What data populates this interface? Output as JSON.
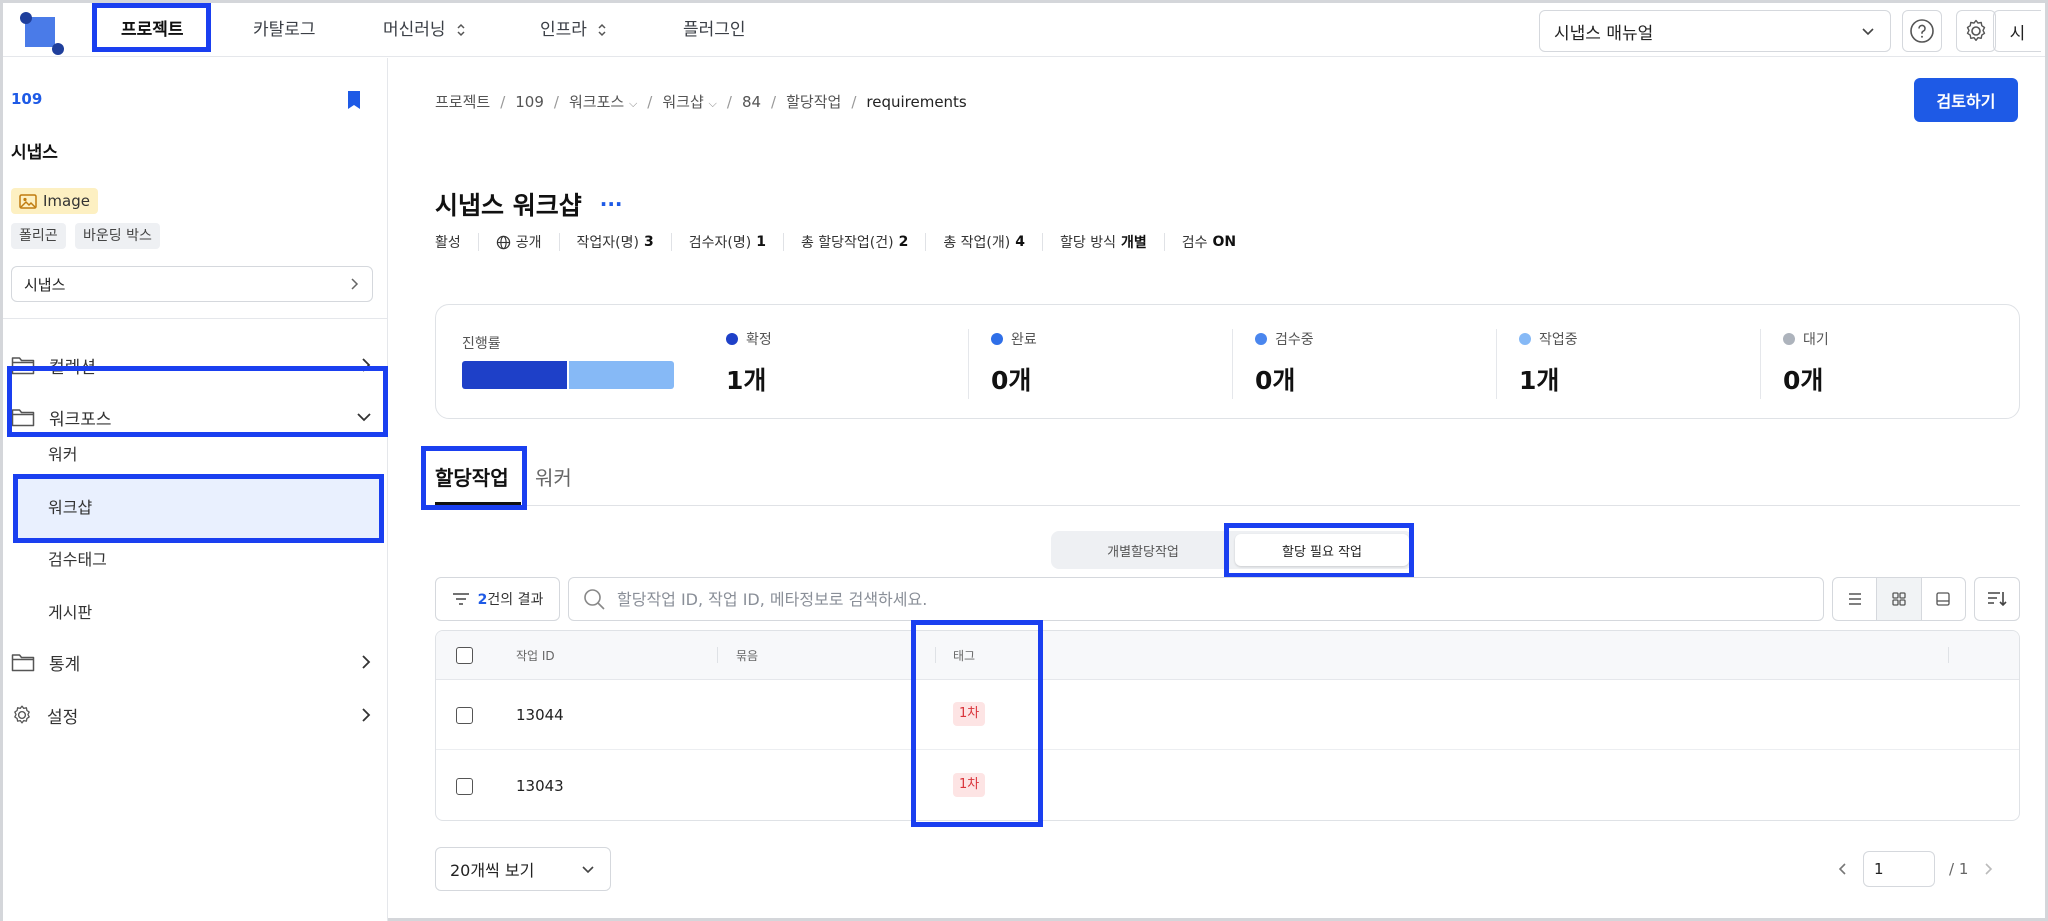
{
  "nav": {
    "items": [
      {
        "label": "프로젝트",
        "active": true,
        "dropdown": false
      },
      {
        "label": "카탈로그",
        "active": false,
        "dropdown": false
      },
      {
        "label": "머신러닝",
        "active": false,
        "dropdown": true
      },
      {
        "label": "인프라",
        "active": false,
        "dropdown": true
      },
      {
        "label": "플러그인",
        "active": false,
        "dropdown": false
      }
    ],
    "manual_select": "시냅스 매뉴얼",
    "avatar": "시"
  },
  "sidebar": {
    "project_id": "109",
    "project_name": "시냅스",
    "data_type": "Image",
    "chips": [
      "폴리곤",
      "바운딩 박스"
    ],
    "workspace_select": "시냅스",
    "menu": {
      "collection": "컬렉션",
      "workforce": "워크포스",
      "workforce_sub": [
        "워커",
        "워크샵",
        "검수태그",
        "게시판"
      ],
      "stats": "통계",
      "settings": "설정"
    }
  },
  "breadcrumb": {
    "items": [
      "프로젝트",
      "109",
      "워크포스",
      "워크샵",
      "84",
      "할당작업",
      "requirements"
    ]
  },
  "review_button": "검토하기",
  "workshop": {
    "title": "시냅스 워크샵",
    "more": "···",
    "meta": {
      "status": "활성",
      "visibility": "공개",
      "workers_label": "작업자(명)",
      "workers_value": "3",
      "reviewers_label": "검수자(명)",
      "reviewers_value": "1",
      "assignments_label": "총 할당작업(건)",
      "assignments_value": "2",
      "tasks_label": "총 작업(개)",
      "tasks_value": "4",
      "method_label": "할당 방식",
      "method_value": "개별",
      "review_label": "검수",
      "review_value": "ON"
    }
  },
  "progress": {
    "label": "진행률",
    "confirmed_fraction": 0.5,
    "working_fraction": 0.5,
    "colors": {
      "confirmed": "#1e40c8",
      "done": "#2f6fe8",
      "reviewing": "#4a86ee",
      "working": "#86b9f6",
      "waiting": "#adb3bc"
    },
    "stats": [
      {
        "label": "확정",
        "value": "1개",
        "color_key": "confirmed"
      },
      {
        "label": "완료",
        "value": "0개",
        "color_key": "done"
      },
      {
        "label": "검수중",
        "value": "0개",
        "color_key": "reviewing"
      },
      {
        "label": "작업중",
        "value": "1개",
        "color_key": "working"
      },
      {
        "label": "대기",
        "value": "0개",
        "color_key": "waiting"
      }
    ]
  },
  "tabs": [
    "할당작업",
    "워커"
  ],
  "segment": {
    "options": [
      "개별할당작업",
      "할당 필요 작업"
    ],
    "selected": 1
  },
  "filter": {
    "count": "2",
    "suffix": "건의 결과"
  },
  "search": {
    "placeholder": "할당작업 ID, 작업 ID, 메타정보로 검색하세요."
  },
  "table": {
    "columns": [
      "작업 ID",
      "묶음",
      "태그"
    ],
    "rows": [
      {
        "id": "13044",
        "group": "",
        "tag": "1차"
      },
      {
        "id": "13043",
        "group": "",
        "tag": "1차"
      }
    ]
  },
  "pagination": {
    "per_page": "20개씩 보기",
    "current": "1",
    "total": "/ 1"
  }
}
